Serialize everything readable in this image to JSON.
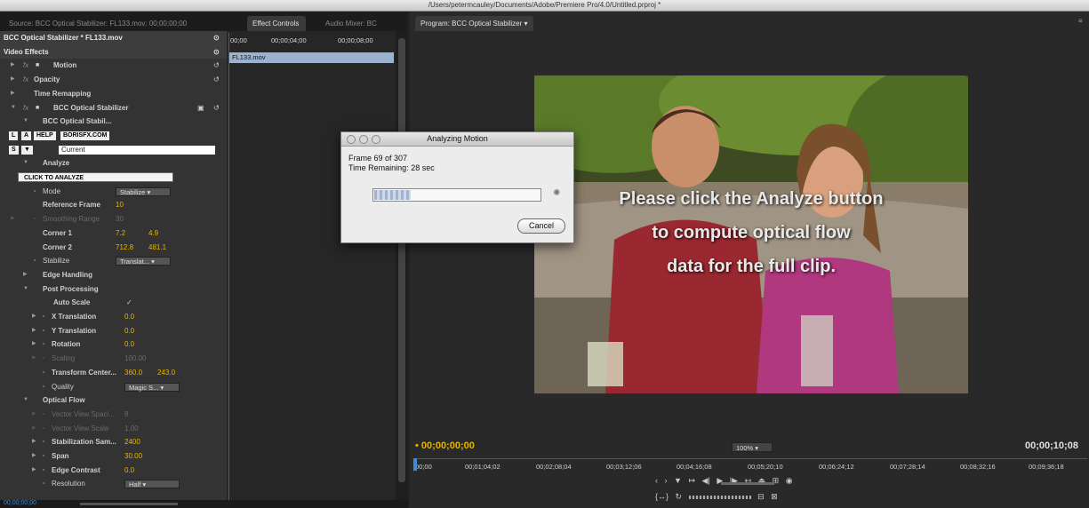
{
  "window": {
    "title": "/Users/petermcauley/Documents/Adobe/Premiere Pro/4.0/Untitled.prproj *"
  },
  "left_tabs": {
    "source": "Source: BCC Optical Stabilizer: FL133.mov: 00;00;00;00",
    "effect_controls": "Effect Controls",
    "audio_mixer": "Audio Mixer: BC"
  },
  "effect_controls": {
    "clip_header": "BCC Optical Stabilizer * FL133.mov",
    "video_effects": "Video Effects",
    "motion": "Motion",
    "opacity": "Opacity",
    "time_remapping": "Time Remapping",
    "bcc": "BCC Optical Stabilizer",
    "bcc_sub": "BCC Optical Stabil...",
    "btn_l": "L",
    "btn_a": "A",
    "btn_help": "HELP",
    "btn_borisfx": "BORISFX.COM",
    "btn_s": "S",
    "btn_v": "▼",
    "preset_value": "Current",
    "analyze": "Analyze",
    "click_to_analyze": "CLICK TO ANALYZE",
    "params": [
      {
        "label": "Mode",
        "value": "Stabilize",
        "kind": "dropdown"
      },
      {
        "label": "Reference Frame",
        "value": "10",
        "kind": "value"
      },
      {
        "label": "Smoothing Range",
        "value": "30",
        "kind": "value",
        "dim": true
      },
      {
        "label": "Corner 1",
        "value": "7.2",
        "value2": "4.9",
        "kind": "pair"
      },
      {
        "label": "Corner 2",
        "value": "712.8",
        "value2": "481.1",
        "kind": "pair"
      },
      {
        "label": "Stabilize",
        "value": "Translat...",
        "kind": "dropdown"
      }
    ],
    "edge_handling": "Edge Handling",
    "post_processing": "Post Processing",
    "auto_scale": "Auto Scale",
    "auto_scale_check": "✓",
    "post_params": [
      {
        "label": "X Translation",
        "value": "0.0"
      },
      {
        "label": "Y Translation",
        "value": "0.0"
      },
      {
        "label": "Rotation",
        "value": "0.0"
      },
      {
        "label": "Scaling",
        "value": "100.00",
        "dim": true
      }
    ],
    "transform_center": "Transform Center...",
    "transform_center_x": "360.0",
    "transform_center_y": "243.0",
    "quality": "Quality",
    "quality_value": "Magic S...",
    "optical_flow": "Optical Flow",
    "flow_params": [
      {
        "label": "Vector View Spaci...",
        "value": "8",
        "dim": true
      },
      {
        "label": "Vector View Scale",
        "value": "1.00",
        "dim": true
      },
      {
        "label": "Stabilization Sam...",
        "value": "2400"
      },
      {
        "label": "Span",
        "value": "30.00"
      },
      {
        "label": "Edge Contrast",
        "value": "0.0"
      }
    ],
    "resolution": "Resolution",
    "resolution_value": "Half",
    "bottom_timecode": "00;00;00;00"
  },
  "ec_timeline": {
    "ticks": [
      "00;00",
      "00;00;04;00",
      "00;00;08;00"
    ],
    "clip": "FL133.mov"
  },
  "program": {
    "tab": "Program: BCC Optical Stabilizer",
    "overlay_lines": [
      "Please click the Analyze button",
      "to compute optical flow",
      "data for the full clip."
    ],
    "timecode_left": "00;00;00;00",
    "zoom": "100%",
    "timecode_right": "00;00;10;08",
    "ruler_ticks": [
      "00;00",
      "00;01;04;02",
      "00;02;08;04",
      "00;03;12;06",
      "00;04;16;08",
      "00;05;20;10",
      "00;06;24;12",
      "00;07;28;14",
      "00;08;32;16",
      "00;09;36;18"
    ]
  },
  "dialog": {
    "title": "Analyzing Motion",
    "frame_line": "Frame 69 of 307",
    "time_line": "Time Remaining: 28 sec",
    "progress": 0.22,
    "cancel": "Cancel"
  }
}
